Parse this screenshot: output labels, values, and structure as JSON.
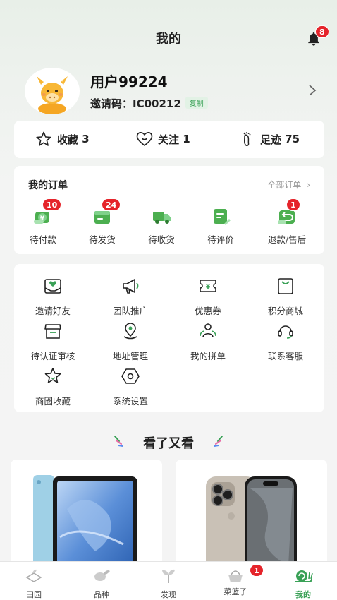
{
  "header": {
    "title": "我的",
    "notification_count": "8"
  },
  "profile": {
    "username": "用户99224",
    "invite_label": "邀请码：",
    "invite_code": "IC00212",
    "copy_label": "复制"
  },
  "stats": [
    {
      "label": "收藏",
      "value": "3"
    },
    {
      "label": "关注",
      "value": "1"
    },
    {
      "label": "足迹",
      "value": "75"
    }
  ],
  "orders": {
    "title": "我的订单",
    "all_label": "全部订单",
    "items": [
      {
        "label": "待付款",
        "badge": "10"
      },
      {
        "label": "待发货",
        "badge": "24"
      },
      {
        "label": "待收货",
        "badge": ""
      },
      {
        "label": "待评价",
        "badge": ""
      },
      {
        "label": "退款/售后",
        "badge": "1"
      }
    ]
  },
  "tools": [
    {
      "label": "邀请好友",
      "icon": "envelope-icon"
    },
    {
      "label": "团队推广",
      "icon": "megaphone-icon"
    },
    {
      "label": "优惠券",
      "icon": "coupon-icon"
    },
    {
      "label": "积分商城",
      "icon": "shopping-bag-icon"
    },
    {
      "label": "待认证审核",
      "icon": "store-icon"
    },
    {
      "label": "地址管理",
      "icon": "location-pin-icon"
    },
    {
      "label": "我的拼单",
      "icon": "group-icon"
    },
    {
      "label": "联系客服",
      "icon": "headset-icon"
    },
    {
      "label": "商圈收藏",
      "icon": "star-icon"
    },
    {
      "label": "系统设置",
      "icon": "settings-icon"
    }
  ],
  "recommend": {
    "title": "看了又看"
  },
  "tabbar": [
    {
      "label": "田园",
      "badge": ""
    },
    {
      "label": "品种",
      "badge": ""
    },
    {
      "label": "发现",
      "badge": ""
    },
    {
      "label": "菜篮子",
      "badge": "1"
    },
    {
      "label": "我的",
      "badge": ""
    }
  ],
  "colors": {
    "accent": "#3aa157",
    "badge": "#e5242b",
    "background": "#f4f4f4"
  }
}
